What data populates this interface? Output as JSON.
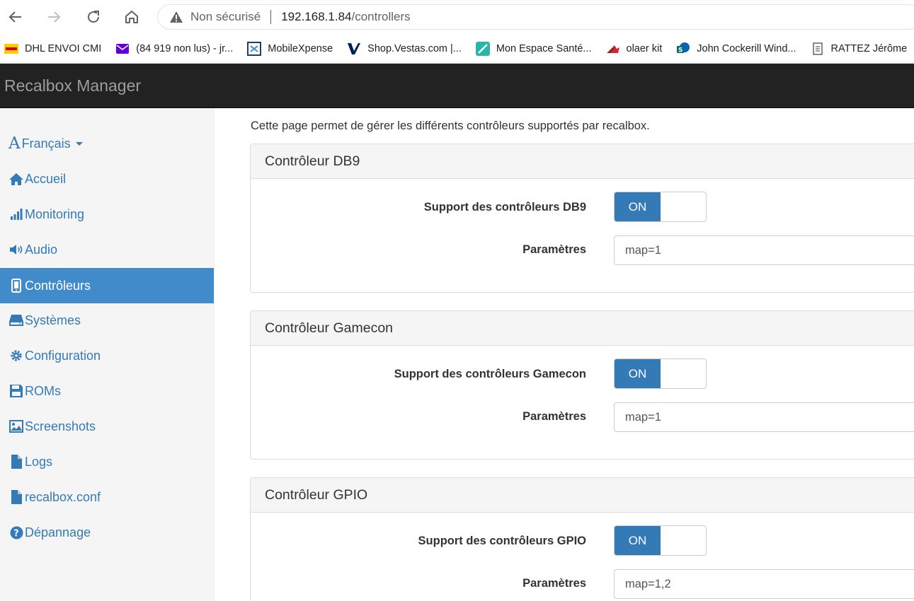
{
  "browser": {
    "security_label": "Non sécurisé",
    "url_host": "192.168.1.84",
    "url_path": "/controllers",
    "bookmarks": [
      {
        "label": "DHL ENVOI CMI",
        "icon": "dhl-icon"
      },
      {
        "label": "(84 919 non lus) - jr...",
        "icon": "yahoo-mail-icon"
      },
      {
        "label": "MobileXpense",
        "icon": "mobilexpense-icon"
      },
      {
        "label": "Shop.Vestas.com |...",
        "icon": "vestas-icon"
      },
      {
        "label": "Mon Espace Santé...",
        "icon": "health-space-icon"
      },
      {
        "label": "olaer kit",
        "icon": "olaer-icon"
      },
      {
        "label": "John Cockerill Wind...",
        "icon": "sharepoint-icon"
      },
      {
        "label": "RATTEZ Jérôme",
        "icon": "document-icon"
      }
    ]
  },
  "app": {
    "brand": "Recalbox Manager"
  },
  "sidebar": {
    "language": "Français",
    "items": [
      {
        "label": "Accueil",
        "icon": "home-icon"
      },
      {
        "label": "Monitoring",
        "icon": "signal-icon"
      },
      {
        "label": "Audio",
        "icon": "volume-icon"
      },
      {
        "label": "Contrôleurs",
        "icon": "phone-icon",
        "active": true
      },
      {
        "label": "Systèmes",
        "icon": "hdd-icon"
      },
      {
        "label": "Configuration",
        "icon": "cog-icon"
      },
      {
        "label": "ROMs",
        "icon": "floppy-icon"
      },
      {
        "label": "Screenshots",
        "icon": "picture-icon"
      },
      {
        "label": "Logs",
        "icon": "file-icon"
      },
      {
        "label": "recalbox.conf",
        "icon": "file-icon"
      },
      {
        "label": "Dépannage",
        "icon": "question-icon"
      }
    ]
  },
  "main": {
    "intro": "Cette page permet de gérer les différents contrôleurs supportés par recalbox.",
    "panels": [
      {
        "title": "Contrôleur DB9",
        "support_label": "Support des contrôleurs DB9",
        "toggle": "ON",
        "params_label": "Paramètres",
        "params_value": "map=1"
      },
      {
        "title": "Contrôleur Gamecon",
        "support_label": "Support des contrôleurs Gamecon",
        "toggle": "ON",
        "params_label": "Paramètres",
        "params_value": "map=1"
      },
      {
        "title": "Contrôleur GPIO",
        "support_label": "Support des contrôleurs GPIO",
        "toggle": "ON",
        "params_label": "Paramètres",
        "params_value": "map=1,2"
      }
    ]
  },
  "colors": {
    "navbar": "#222222",
    "link": "#337ab7",
    "active": "#428bca",
    "toggle_on": "#337ab7"
  }
}
